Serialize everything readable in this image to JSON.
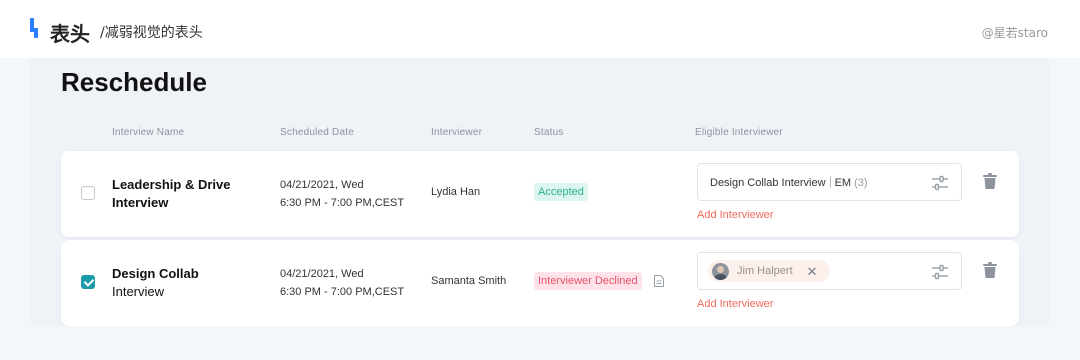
{
  "header": {
    "title": "表头",
    "subtitle": "/减弱视觉的表头",
    "credit": "@星若staro"
  },
  "page": {
    "title": "Reschedule"
  },
  "columns": [
    "Interview Name",
    "Scheduled Date",
    "Interviewer",
    "Status",
    "Eligible Interviewer"
  ],
  "rows": [
    {
      "checked": false,
      "name_bold": "Leadership & Drive",
      "name_rest": "Interview",
      "date_line1": "04/21/2021, Wed",
      "date_line2": "6:30 PM - 7:00 PM,CEST",
      "interviewer": "Lydia Han",
      "status": "Accepted",
      "eligible_text": "Design Collab Interview",
      "eligible_role": "EM",
      "eligible_count": "(3)",
      "add_label": "Add Interviewer"
    },
    {
      "checked": true,
      "name_bold": "Design Collab",
      "name_rest": "Interview",
      "date_line1": "04/21/2021, Wed",
      "date_line2": "6:30 PM - 7:00 PM,CEST",
      "interviewer": "Samanta Smith",
      "status": "Interviewer Declined",
      "chip_name": "Jim Halpert",
      "chip_close": "✕",
      "add_label": "Add Interviewer"
    }
  ],
  "colors": {
    "accent": "#2d7ff9",
    "checked": "#1c9bab",
    "accepted_text": "#2cb394",
    "accepted_bg": "#dcf5ee",
    "declined_text": "#e8526d",
    "declined_bg": "#fde3e8",
    "add_link": "#f06b5e"
  },
  "icons": [
    "logo-icon",
    "sliders-icon",
    "trash-icon",
    "document-icon",
    "close-icon",
    "avatar"
  ]
}
